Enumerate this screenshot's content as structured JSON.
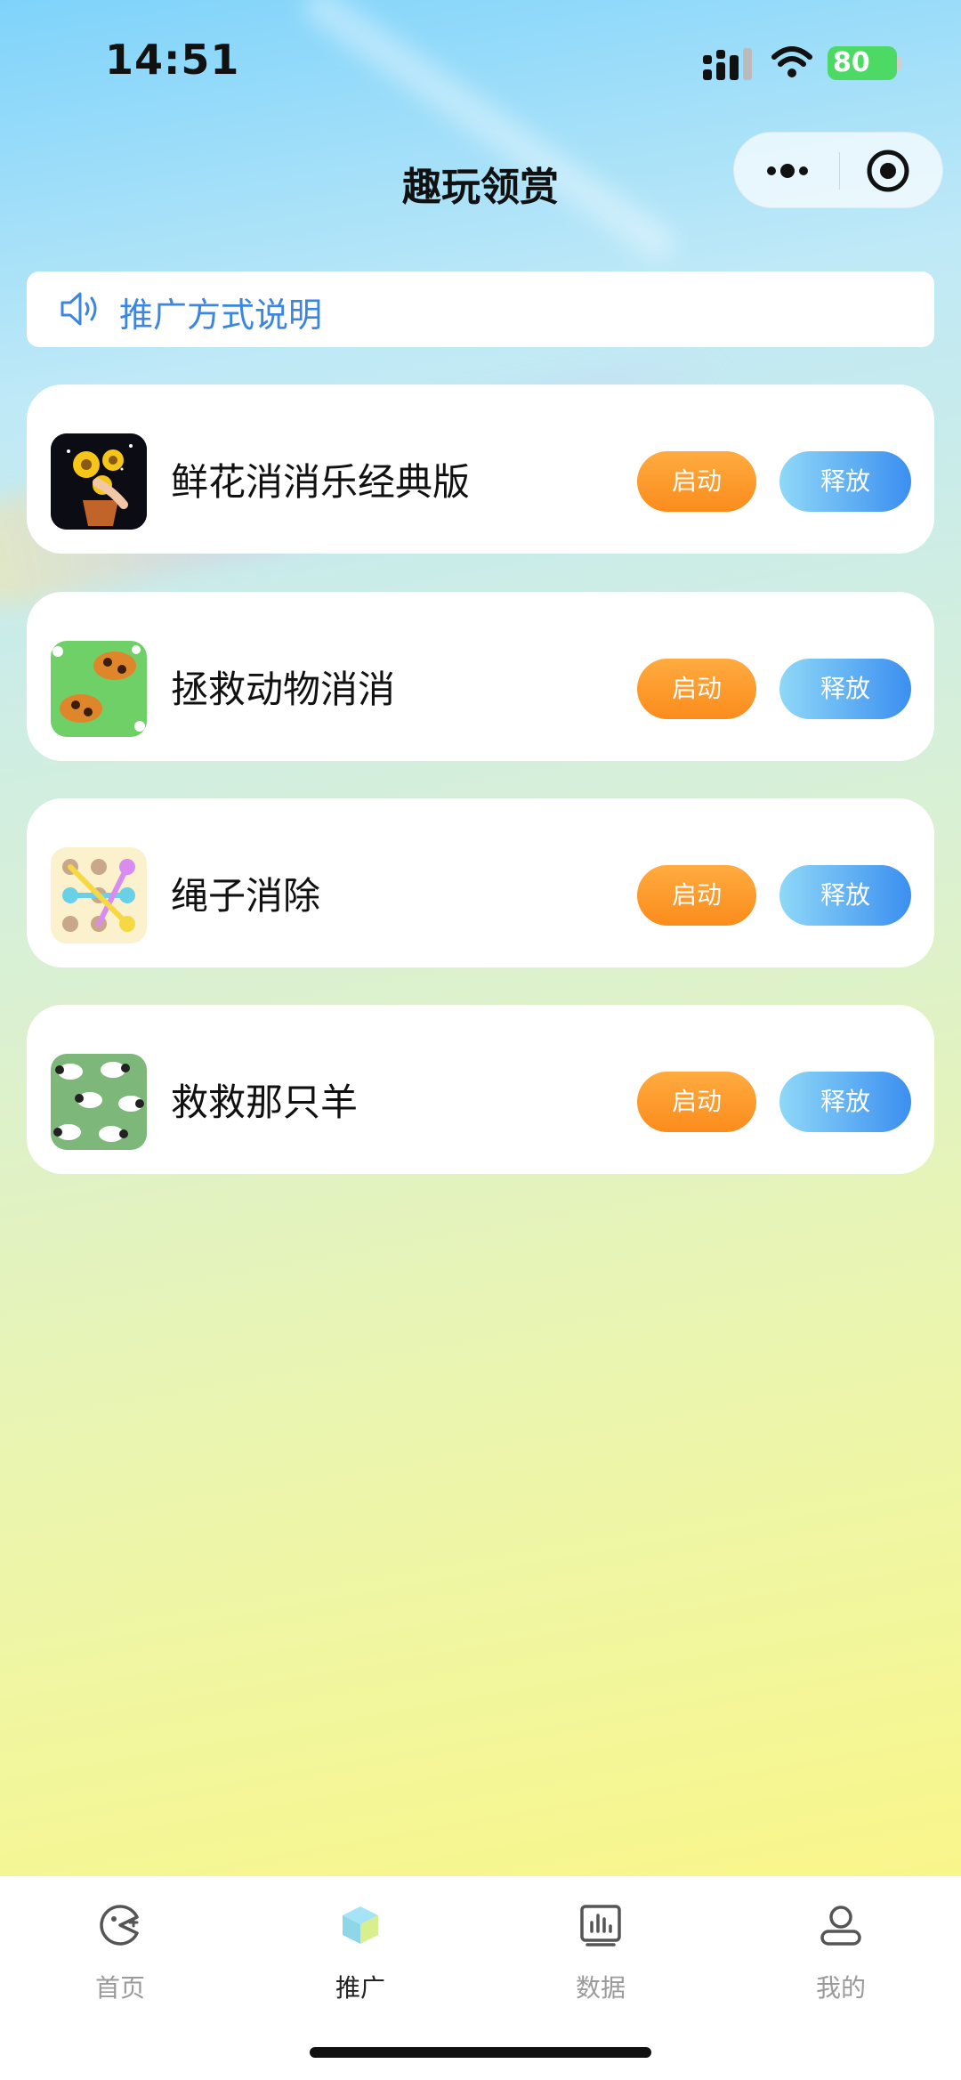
{
  "status_bar": {
    "time": "14:51",
    "battery": "80"
  },
  "header": {
    "title": "趣玩领赏"
  },
  "notice": {
    "text": "推广方式说明"
  },
  "games": [
    {
      "name": "鲜花消消乐经典版",
      "start_label": "启动",
      "release_label": "释放"
    },
    {
      "name": "拯救动物消消",
      "start_label": "启动",
      "release_label": "释放"
    },
    {
      "name": "绳子消除",
      "start_label": "启动",
      "release_label": "释放"
    },
    {
      "name": "救救那只羊",
      "start_label": "启动",
      "release_label": "释放"
    }
  ],
  "tabbar": {
    "tabs": [
      {
        "label": "首页",
        "icon": "game-controller-icon"
      },
      {
        "label": "推广",
        "icon": "cube-icon",
        "active": true
      },
      {
        "label": "数据",
        "icon": "chart-icon"
      },
      {
        "label": "我的",
        "icon": "person-icon"
      }
    ]
  },
  "colors": {
    "accent_orange": "#fb8c1c",
    "accent_blue": "#3b8ff0",
    "notice_text": "#3a86e0"
  }
}
